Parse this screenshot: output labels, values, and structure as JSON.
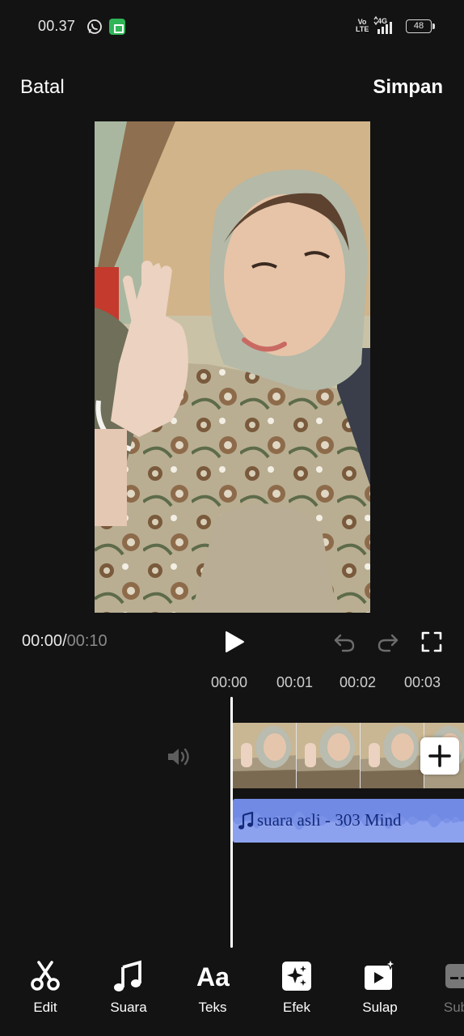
{
  "status_bar": {
    "time": "00.37",
    "volte": "Vo LTE",
    "network": "4G",
    "battery": "48"
  },
  "header": {
    "cancel_label": "Batal",
    "save_label": "Simpan"
  },
  "player": {
    "current_time": "00:00",
    "separator": "/",
    "total_time": "00:10"
  },
  "timeline": {
    "ruler": [
      "00:00",
      "00:01",
      "00:02",
      "00:03"
    ],
    "audio_track_title": "suara asli - 303 Mind"
  },
  "toolbar": {
    "items": [
      {
        "label": "Edit",
        "icon": "scissors-icon"
      },
      {
        "label": "Suara",
        "icon": "music-note-icon"
      },
      {
        "label": "Teks",
        "icon": "text-aa-icon"
      },
      {
        "label": "Efek",
        "icon": "sparkle-effect-icon"
      },
      {
        "label": "Sulap",
        "icon": "magic-video-icon"
      },
      {
        "label": "Sub",
        "icon": "subtitle-icon"
      }
    ]
  },
  "colors": {
    "background": "#131313",
    "audio_track": "#7b92e8",
    "audio_text": "#142a7a",
    "status_app_icon": "#2fb457"
  }
}
